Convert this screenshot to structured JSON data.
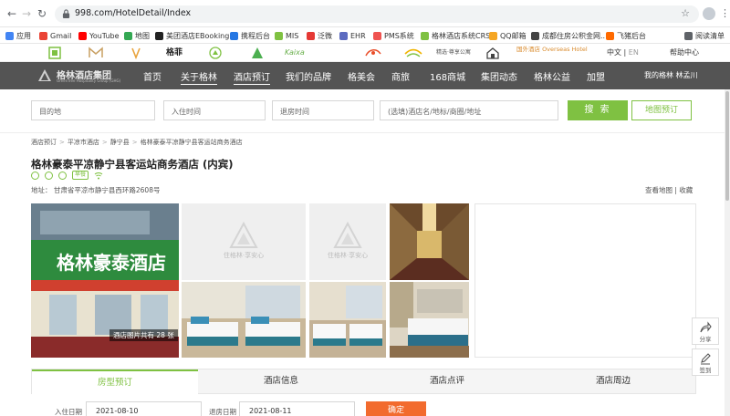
{
  "browser": {
    "url": "998.com/HotelDetail/Index",
    "bookmarks": [
      {
        "label": "应用",
        "color": "#4285f4"
      },
      {
        "label": "Gmail",
        "color": "#ea4335"
      },
      {
        "label": "YouTube",
        "color": "#ff0000"
      },
      {
        "label": "地图",
        "color": "#34a853"
      },
      {
        "label": "美团酒店EBooking",
        "color": "#222222"
      },
      {
        "label": "携程后台",
        "color": "#2577e3"
      },
      {
        "label": "MIS",
        "color": "#7fc142"
      },
      {
        "label": "泛微",
        "color": "#e53935"
      },
      {
        "label": "EHR",
        "color": "#5c6bc0"
      },
      {
        "label": "PMS系统",
        "color": "#ef5350"
      },
      {
        "label": "格林酒店系统CRS",
        "color": "#7fc142"
      },
      {
        "label": "QQ邮箱",
        "color": "#f5a623"
      },
      {
        "label": "成都住房公积金网...",
        "color": "#444444"
      },
      {
        "label": "飞猪后台",
        "color": "#ff6a00"
      },
      {
        "label": "阅读清单",
        "color": "#5f6368"
      }
    ]
  },
  "brand_strip": {
    "brands": [
      "",
      "",
      "",
      "格菲",
      "",
      "",
      "Kaixa",
      "",
      "精选·尊享公寓",
      "",
      "国外酒店 Overseas Hotel"
    ],
    "lang_label": "中文",
    "lang_alt": "EN",
    "help": "帮助中心"
  },
  "nav": {
    "logo_title": "格林酒店集团",
    "logo_sub": "GreenTree Hospitality Group (GHG)",
    "items": [
      "首页",
      "关于格林",
      "酒店预订",
      "我们的品牌",
      "格美会",
      "商旅",
      "168商城",
      "集团动态",
      "格林公益",
      "加盟"
    ],
    "right": "我的格林   林孟川"
  },
  "search": {
    "destination": "目的地",
    "checkin": "入住时间",
    "checkout": "退房时间",
    "keyword": "(选填)酒店名/地标/商圈/地址",
    "search_btn": "搜 索",
    "map_btn": "地图预订"
  },
  "breadcrumb": [
    "酒店预订",
    "平凉市酒店",
    "静宁县",
    "格林豪泰平凉静宁县客运站商务酒店"
  ],
  "hotel": {
    "name": "格林豪泰平凉静宁县客运站商务酒店 (内宾)",
    "badge": "早餐",
    "address": "地址： 甘肃省平凉市静宁县西环路2608号",
    "map_link": "查看地图",
    "fav_link": "收藏",
    "photo_count": "酒店图片共有 28 张",
    "placeholder_text": "住格林·享安心",
    "storefront_sign": "格林豪泰酒店"
  },
  "tabs": [
    "房型预订",
    "酒店信息",
    "酒店点评",
    "酒店周边"
  ],
  "booking": {
    "checkin_label": "入住日期",
    "checkin_value": "2021-08-10",
    "checkout_label": "退房日期",
    "checkout_value": "2021-08-11",
    "confirm": "确定"
  },
  "side": {
    "share": "分享",
    "signin": "签到"
  },
  "colors": {
    "accent": "#7fc142",
    "nav_bg": "#545454",
    "confirm": "#f26b2e"
  }
}
